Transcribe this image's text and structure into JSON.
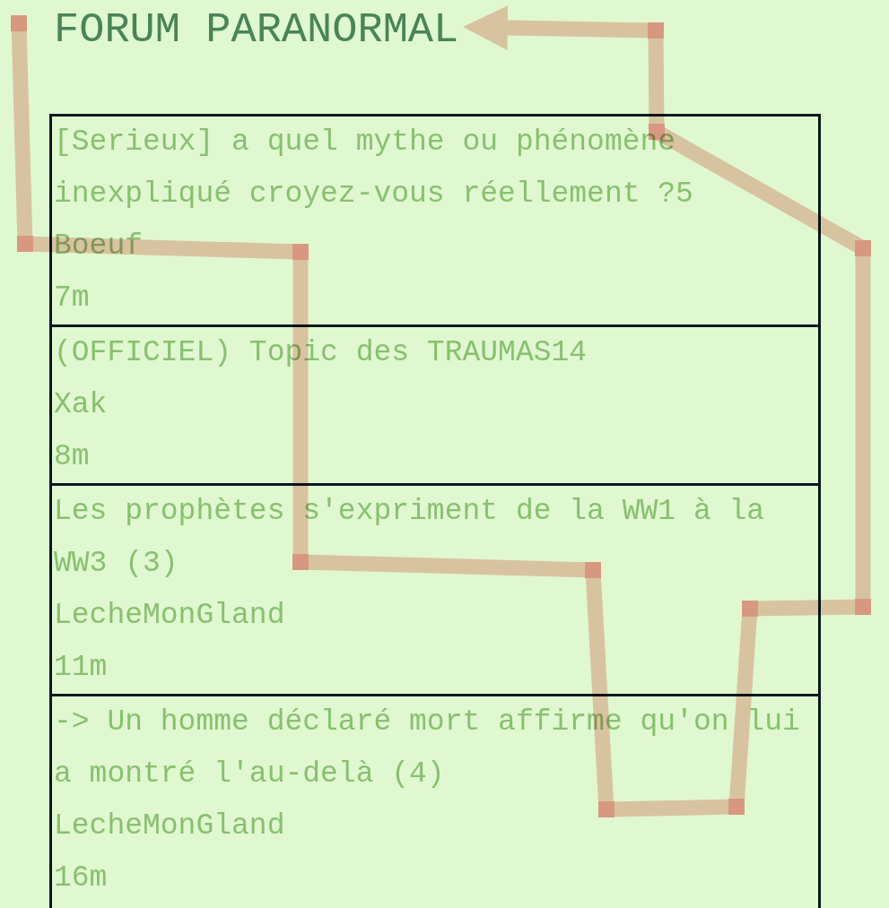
{
  "header": {
    "title": "FORUM PARANORMAL"
  },
  "topics": [
    {
      "title": "[Serieux] a quel mythe ou phénomène inexpliqué croyez-vous réellement ?5",
      "author": "Boeuf",
      "age": "7m"
    },
    {
      "title": "(OFFICIEL) Topic des TRAUMAS14",
      "author": "Xak",
      "age": "8m"
    },
    {
      "title": "Les prophètes s'expriment de la WW1 à la WW3 (3)",
      "author": "LecheMonGland",
      "age": "11m"
    },
    {
      "title": "-> Un homme déclaré mort affirme qu'on lui a montré l'au-delà (4)",
      "author": "LecheMonGland",
      "age": "16m"
    }
  ]
}
